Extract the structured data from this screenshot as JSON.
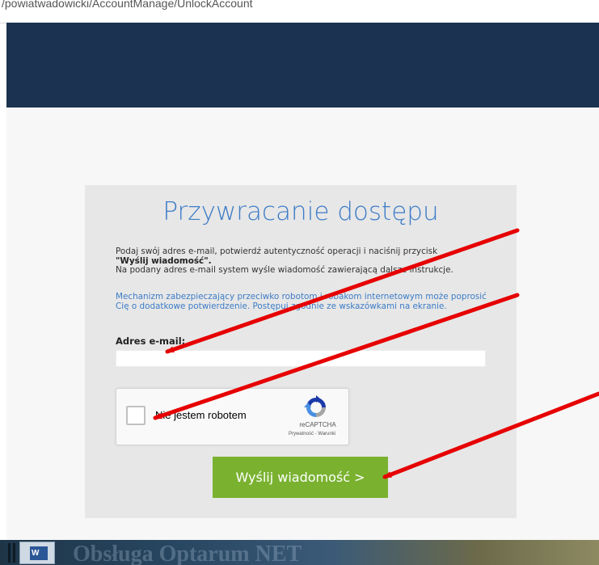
{
  "browser": {
    "url": "/powiatwadowicki/AccountManage/UnlockAccount"
  },
  "panel": {
    "title": "Przywracanie dostępu",
    "instructions_line1": "Podaj swój adres e-mail, potwierdź autentyczność operacji i naciśnij przycisk",
    "instructions_bold": "\"Wyślij wiadomość\".",
    "instructions_line2": "Na podany adres e-mail system wyśle wiadomość zawierającą dalsze instrukcje.",
    "captcha_notice": "Mechanizm zabezpieczający przeciwko robotom i robakom internetowym może poprosić Cię o dodatkowe potwierdzenie. Postępuj zgodnie ze wskazówkami na ekranie.",
    "email_label": "Adres e-mail:",
    "email_value": "",
    "send_button": "Wyślij wiadomość >"
  },
  "recaptcha": {
    "checkbox_label": "Nie jestem robotem",
    "brand": "reCAPTCHA",
    "terms": "Prywatność - Warunki",
    "checked": false
  },
  "taskbar": {
    "word_icon_letter": "W",
    "background_text": "Obsługa Optarum NET"
  },
  "annotations": {
    "arrow_color": "#e60000"
  },
  "colors": {
    "header": "#1b3350",
    "title": "#3d7cc7",
    "button": "#7ab230",
    "panel": "#e7e7e7"
  }
}
